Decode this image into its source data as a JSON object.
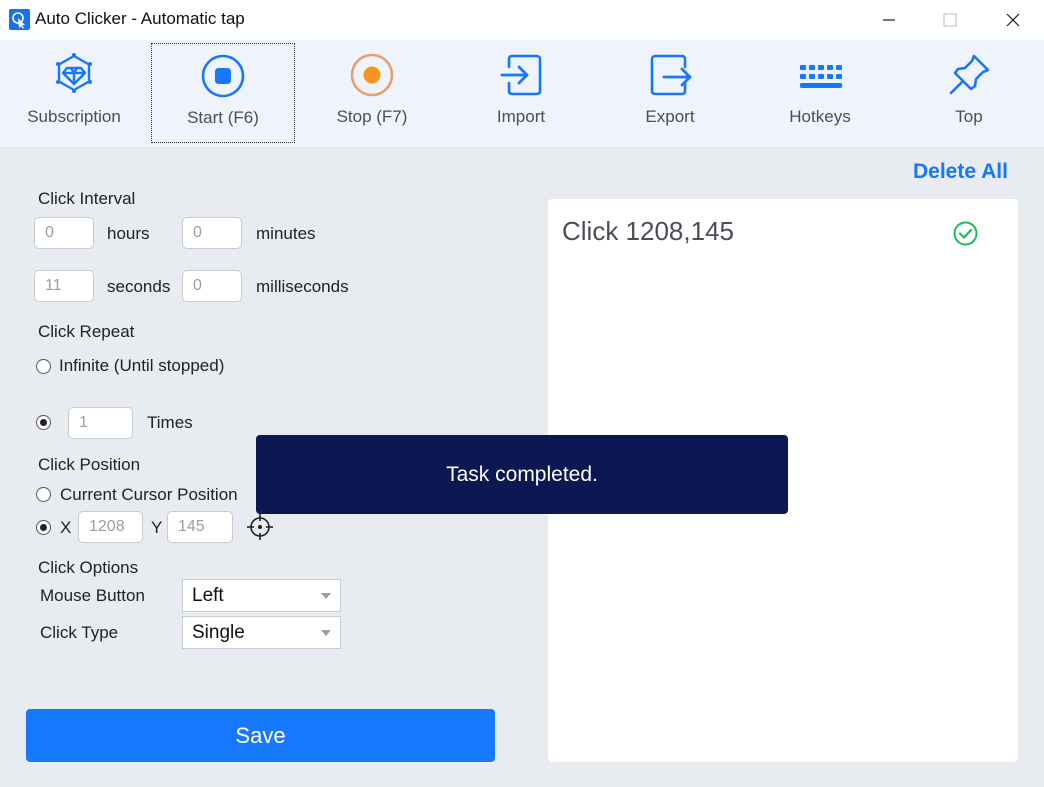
{
  "window": {
    "title": "Auto Clicker - Automatic tap",
    "icon": "cursor-click-icon"
  },
  "toolbar": {
    "items": [
      {
        "label": "Subscription",
        "icon": "diamond-icon"
      },
      {
        "label": "Start (F6)",
        "icon": "start-record-icon"
      },
      {
        "label": "Stop (F7)",
        "icon": "stop-record-icon"
      },
      {
        "label": "Import",
        "icon": "import-icon"
      },
      {
        "label": "Export",
        "icon": "export-icon"
      },
      {
        "label": "Hotkeys",
        "icon": "keyboard-icon"
      },
      {
        "label": "Top",
        "icon": "pin-icon"
      }
    ]
  },
  "click_interval": {
    "title": "Click Interval",
    "hours": {
      "value": "0",
      "unit": "hours"
    },
    "minutes": {
      "value": "0",
      "unit": "minutes"
    },
    "seconds": {
      "value": "11",
      "unit": "seconds"
    },
    "milliseconds": {
      "value": "0",
      "unit": "milliseconds"
    }
  },
  "click_repeat": {
    "title": "Click Repeat",
    "infinite_label": "Infinite (Until stopped)",
    "times_value": "1",
    "times_label": "Times",
    "selected": "times"
  },
  "click_position": {
    "title": "Click Position",
    "current_label": "Current Cursor Position",
    "x_label": "X",
    "x_value": "1208",
    "y_label": "Y",
    "y_value": "145",
    "selected": "xy"
  },
  "click_options": {
    "title": "Click Options",
    "mouse_button_label": "Mouse Button",
    "mouse_button_value": "Left",
    "click_type_label": "Click Type",
    "click_type_value": "Single"
  },
  "save_label": "Save",
  "task_list": {
    "delete_all_label": "Delete All",
    "items": [
      {
        "label": "Click 1208,145",
        "status": "completed"
      }
    ]
  },
  "toast": {
    "message": "Task completed."
  },
  "colors": {
    "accent": "#1677ff",
    "toast_bg": "#0b1851",
    "success": "#20b85a",
    "stop_icon": "#f7941d"
  }
}
